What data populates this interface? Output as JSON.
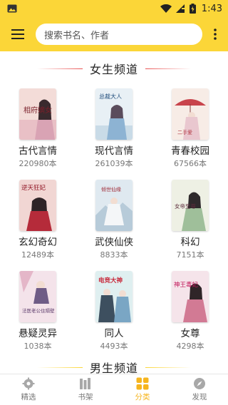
{
  "status": {
    "time": "1:43"
  },
  "header": {
    "search_placeholder": "搜索书名、作者"
  },
  "sections": [
    {
      "title": "女生频道"
    },
    {
      "title": "男生频道"
    }
  ],
  "categories": [
    {
      "name": "古代言情",
      "count": "220980本",
      "cover_title": "相府嫡女"
    },
    {
      "name": "现代言情",
      "count": "261039本",
      "cover_title": "总裁大人"
    },
    {
      "name": "青春校园",
      "count": "67566本",
      "cover_title": "二手爱"
    },
    {
      "name": "玄幻奇幻",
      "count": "12489本",
      "cover_title": "逆天狂妃"
    },
    {
      "name": "武侠仙侠",
      "count": "8833本",
      "cover_title": "倾世仙缘"
    },
    {
      "name": "科幻",
      "count": "7151本",
      "cover_title": "女帝至尊"
    },
    {
      "name": "悬疑灵异",
      "count": "1038本",
      "cover_title": "法医老公住隔壁"
    },
    {
      "name": "同人",
      "count": "4493本",
      "cover_title": "电竞大神"
    },
    {
      "name": "女尊",
      "count": "4298本",
      "cover_title": "神王毒妃"
    }
  ],
  "bottom_nav": [
    {
      "label": "精选",
      "icon": "gear-icon",
      "active": false
    },
    {
      "label": "书架",
      "icon": "bookshelf-icon",
      "active": false
    },
    {
      "label": "分类",
      "icon": "grid-icon",
      "active": true
    },
    {
      "label": "发现",
      "icon": "compass-icon",
      "active": false
    }
  ],
  "colors": {
    "accent": "#fbd638",
    "active_tab": "#f6b51e",
    "section_line": "#e95050"
  }
}
